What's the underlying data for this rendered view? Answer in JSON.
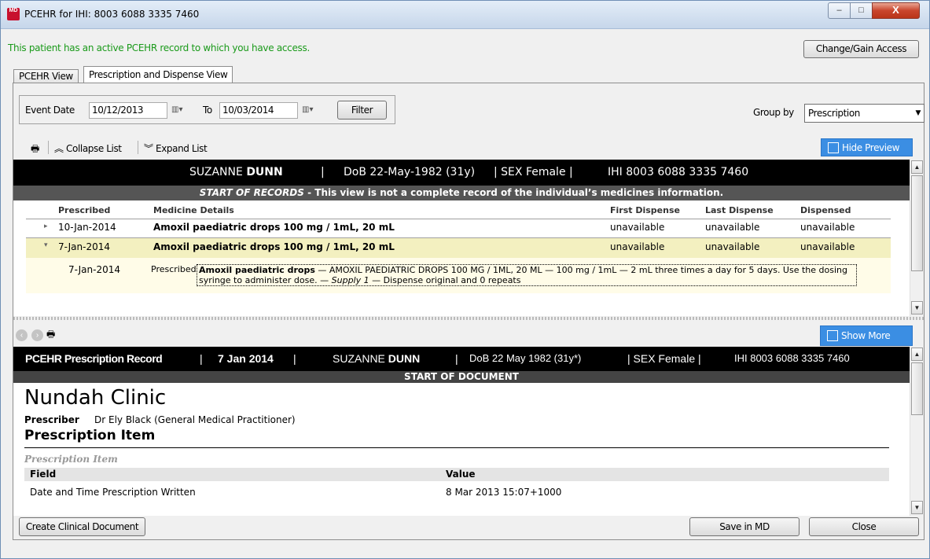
{
  "window": {
    "title": "PCEHR for IHI: 8003 6088 3335 7460",
    "icon_text": "MD",
    "minimize": "–",
    "maximize": "□",
    "close": "X"
  },
  "access_message": "This patient has an active PCEHR record to which you have access.",
  "change_access_label": "Change/Gain Access",
  "tabs": [
    {
      "label": "PCEHR View",
      "active": false
    },
    {
      "label": "Prescription and Dispense View",
      "active": true
    }
  ],
  "filter": {
    "event_date_label": "Event Date",
    "from_value": "10/12/2013",
    "to_label": "To",
    "to_value": "10/03/2014",
    "filter_button": "Filter",
    "group_by_label": "Group by",
    "group_by_value": "Prescription"
  },
  "toolbar": {
    "collapse_label": "Collapse List",
    "expand_label": "Expand List",
    "hide_preview_label": "Hide Preview",
    "show_more_label": "Show More"
  },
  "patient_header": {
    "first_name": "SUZANNE",
    "last_name": "DUNN",
    "sep": "|",
    "dob": "DoB 22-May-1982 (31y)",
    "sex": "| SEX Female |",
    "ihi": "IHI 8003 6088 3335 7460"
  },
  "start_records": {
    "strong": "START OF RECORDS",
    "rest": " - This view is not a complete record of the individual’s medicines information."
  },
  "list": {
    "columns": [
      "Prescribed",
      "Medicine Details",
      "First Dispense",
      "Last Dispense",
      "Dispensed"
    ],
    "rows": [
      {
        "expander": "▸",
        "date": "10-Jan-2014",
        "medicine": "Amoxil paediatric drops 100 mg / 1mL, 20 mL",
        "first": "unavailable",
        "last": "unavailable",
        "dispensed": "unavailable"
      },
      {
        "expander": "▾",
        "date": "7-Jan-2014",
        "medicine": "Amoxil paediatric drops 100 mg / 1mL, 20 mL",
        "first": "unavailable",
        "last": "unavailable",
        "dispensed": "unavailable"
      }
    ],
    "detail": {
      "date": "7-Jan-2014",
      "status": "Prescribed",
      "med_name": "Amoxil paediatric drops",
      "text1": " — AMOXIL PAEDIATRIC DROPS 100 MG / 1ML, 20 ML — 100 mg / 1mL — 2 mL three times a day for 5 days. Use the dosing syringe to administer dose. — ",
      "supply": "Supply 1",
      "text2": " — Dispense original and 0 repeats"
    }
  },
  "document": {
    "header_title": "PCEHR Prescription Record",
    "sep": "|",
    "header_date": "7 Jan 2014",
    "first_name": "SUZANNE",
    "last_name": "DUNN",
    "dob": "DoB 22 May 1982 (31y*)",
    "sex": "| SEX Female |",
    "ihi": "IHI 8003 6088 3335 7460",
    "start_label": "START OF DOCUMENT",
    "clinic": "Nundah Clinic",
    "prescriber_label": "Prescriber",
    "prescriber_value": "Dr Ely Black (General Medical Practitioner)",
    "section_title": "Prescription Item",
    "sub_title": "Prescription Item",
    "table_headers": [
      "Field",
      "Value"
    ],
    "table_row": {
      "field": "Date and Time Prescription Written",
      "value": "8 Mar 2013 15:07+1000"
    }
  },
  "footer": {
    "create_label": "Create Clinical Document",
    "save_label": "Save in MD",
    "close_label": "Close"
  },
  "colors": {
    "access_green": "#1a9a1a",
    "preview_blue": "#3b8ee3",
    "highlight_row": "#f3f0c0"
  }
}
